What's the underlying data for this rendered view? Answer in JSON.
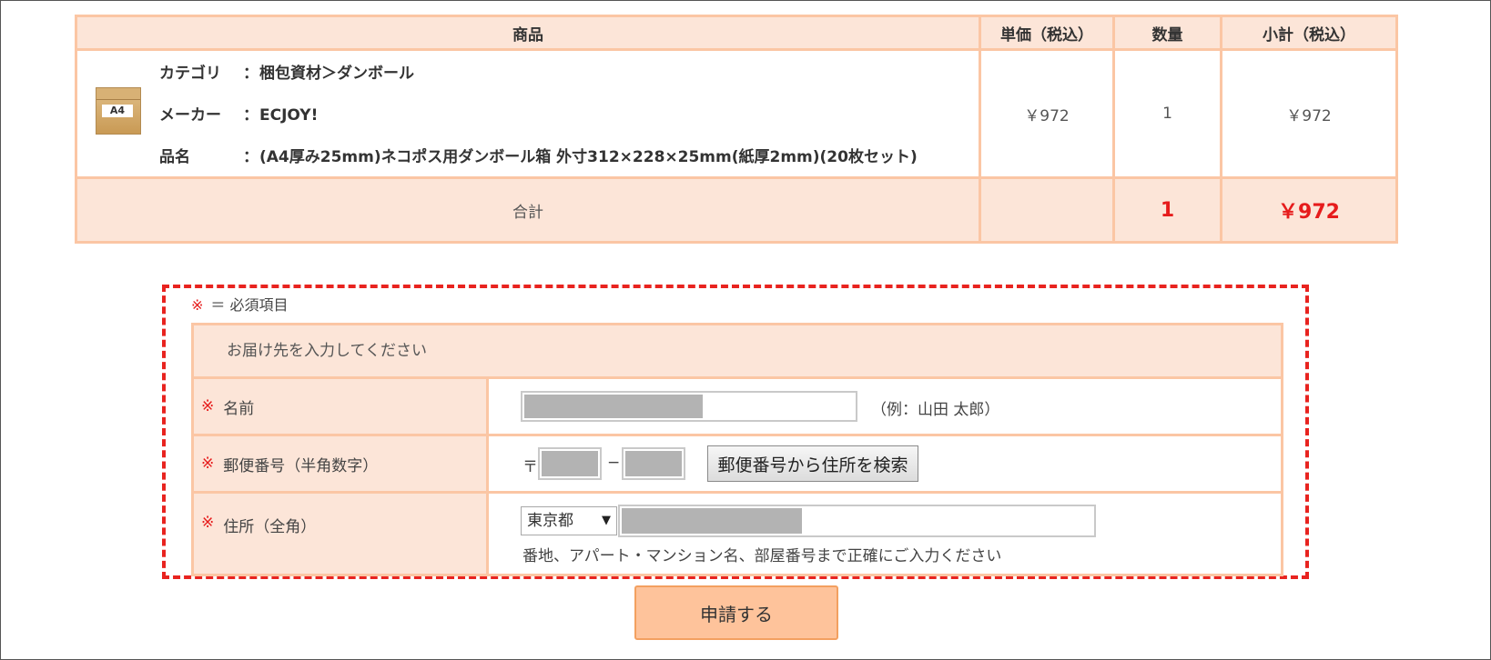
{
  "order_table": {
    "headers": {
      "product": "商品",
      "unit_price": "単価（税込）",
      "quantity": "数量",
      "subtotal": "小計（税込）"
    },
    "item": {
      "image_label": "A4",
      "rows": [
        {
          "key": "カテゴリ",
          "value": "梱包資材＞ダンボール"
        },
        {
          "key": "メーカー",
          "value": "ECJOY!"
        },
        {
          "key": "品名",
          "value": "(A4厚み25mm)ネコポス用ダンボール箱 外寸312×228×25mm(紙厚2mm)(20枚セット)"
        }
      ],
      "colon": "：",
      "unit_price": "￥972",
      "quantity": "1",
      "subtotal": "￥972"
    },
    "total": {
      "label": "合計",
      "quantity": "1",
      "amount": "￥972"
    }
  },
  "form": {
    "required_mark": "※",
    "required_note": "＝ 必須項目",
    "section_title": "お届け先を入力してください",
    "name": {
      "label": "名前",
      "example": "（例：山田 太郎）"
    },
    "postal": {
      "label": "郵便番号（半角数字）",
      "symbol": "〒",
      "separator": "−",
      "search_button": "郵便番号から住所を検索"
    },
    "address": {
      "label": "住所（全角）",
      "prefecture": "東京都",
      "dropdown_arrow": "▼",
      "hint": "番地、アパート・マンション名、部屋番号まで正確にご入力ください"
    },
    "submit_label": "申請する"
  },
  "colors": {
    "accent_red": "#e61c1c",
    "border_peach": "#fbc6a4",
    "header_bg": "#fce5d8",
    "submit_bg": "#fec39b"
  }
}
